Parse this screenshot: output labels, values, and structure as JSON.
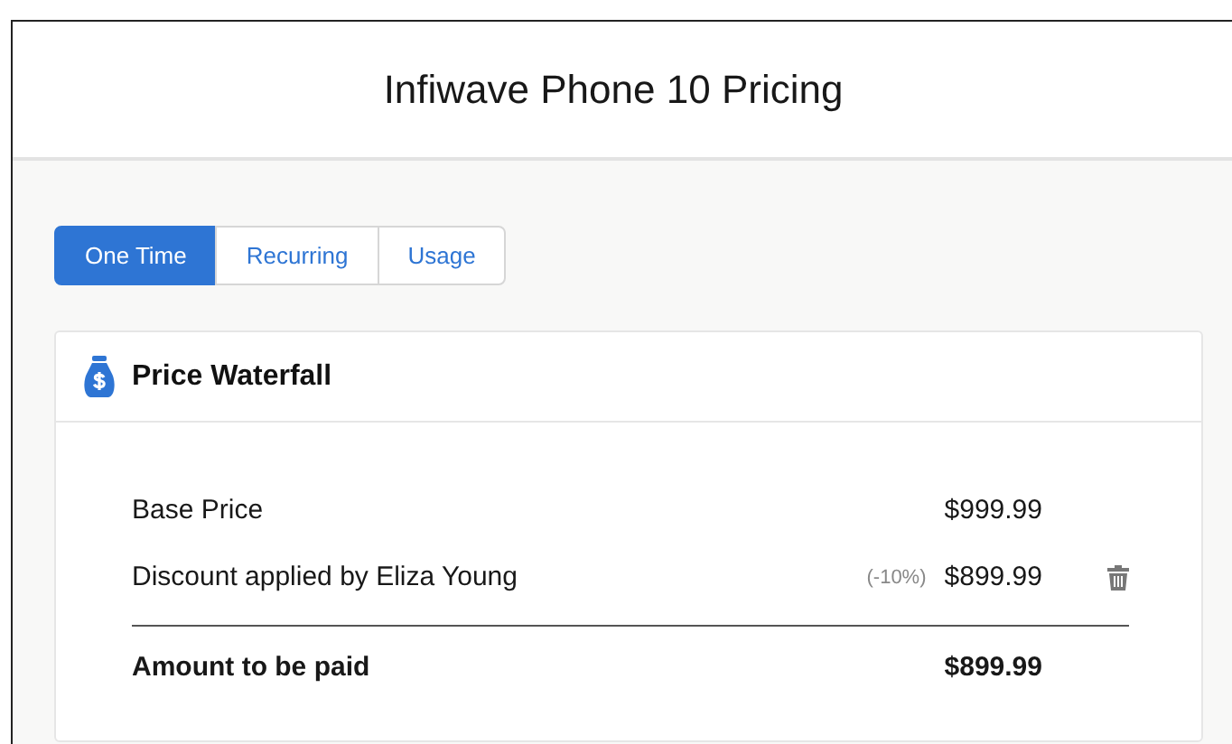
{
  "window": {
    "title": "Infiwave Phone 10 Pricing"
  },
  "tabs": [
    {
      "label": "One Time",
      "selected": true
    },
    {
      "label": "Recurring",
      "selected": false
    },
    {
      "label": "Usage",
      "selected": false
    }
  ],
  "card": {
    "title": "Price Waterfall",
    "rows": [
      {
        "label": "Base Price",
        "price": "$999.99",
        "deletable": false
      },
      {
        "label": "Discount applied by Eliza Young",
        "adjustment": "(-10%)",
        "price": "$899.99",
        "deletable": true
      }
    ],
    "total": {
      "label": "Amount to be paid",
      "price": "$899.99"
    }
  }
}
